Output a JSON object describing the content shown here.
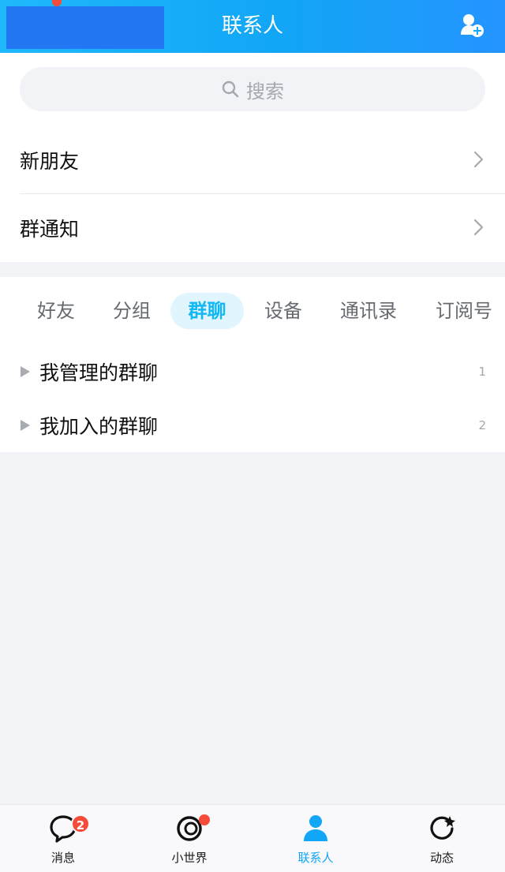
{
  "header": {
    "title": "联系人",
    "add_contact_icon": "add-user-icon",
    "redacted_avatar_color": "#2377f3",
    "unread_dot_color": "#f44b3b"
  },
  "search": {
    "placeholder": "搜索",
    "icon": "search-icon"
  },
  "entries": [
    {
      "label": "新朋友",
      "icon": "chevron-right-icon"
    },
    {
      "label": "群通知",
      "icon": "chevron-right-icon"
    }
  ],
  "tabs": [
    {
      "label": "好友",
      "active": false
    },
    {
      "label": "分组",
      "active": false
    },
    {
      "label": "群聊",
      "active": true
    },
    {
      "label": "设备",
      "active": false
    },
    {
      "label": "通讯录",
      "active": false
    },
    {
      "label": "订阅号",
      "active": false
    }
  ],
  "groups": [
    {
      "title": "我管理的群聊",
      "count": "1"
    },
    {
      "title": "我加入的群聊",
      "count": "2"
    }
  ],
  "bottom_nav": [
    {
      "label": "消息",
      "icon": "chat-bubble-icon",
      "badge": "2",
      "active": false
    },
    {
      "label": "小世界",
      "icon": "small-world-icon",
      "dot": true,
      "active": false
    },
    {
      "label": "联系人",
      "icon": "contact-person-icon",
      "active": true
    },
    {
      "label": "动态",
      "icon": "refresh-star-icon",
      "active": false
    }
  ],
  "colors": {
    "accent": "#12b7f5",
    "header_gradient_start": "#1fb8fb",
    "header_gradient_end": "#2594ff",
    "badge": "#f44b3b",
    "background": "#f3f4f7"
  }
}
